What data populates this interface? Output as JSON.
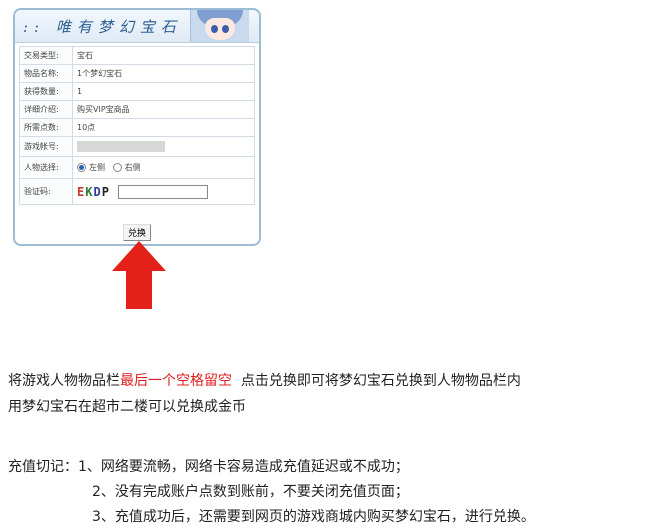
{
  "panel": {
    "title": "唯有梦幻宝石",
    "title_prefix": "::",
    "rows": [
      {
        "label": "交易类型:",
        "value": "宝石"
      },
      {
        "label": "物品名称:",
        "value": "1个梦幻宝石"
      },
      {
        "label": "获得数量:",
        "value": "1"
      },
      {
        "label": "详细介绍:",
        "value": "购买VIP宝商品"
      },
      {
        "label": "所需点数:",
        "value": "10点"
      }
    ],
    "account_label": "游戏帐号:",
    "character_label": "人物选择:",
    "radio_left": "左侧",
    "radio_right": "右侧",
    "captcha_label": "验证码:",
    "captcha_chars": [
      "E",
      "K",
      "D",
      "P"
    ],
    "captcha_value": "",
    "submit_label": "兑换"
  },
  "instructions": {
    "line1_prefix": "将游戏人物物品栏",
    "line1_highlight": "最后一个空格留空",
    "line1_suffix": "  点击兑换即可将梦幻宝石兑换到人物物品栏内",
    "line2": "用梦幻宝石在超市二楼可以兑换成金币"
  },
  "notes": {
    "line1": "充值切记：1、网络要流畅，网络卡容易造成充值延迟或不成功；",
    "line2": "2、没有完成账户点数到账前，不要关闭充值页面；",
    "line3": "3、充值成功后，还需要到网页的游戏商城内购买梦幻宝石，进行兑换。"
  },
  "colors": {
    "accent": "#2c5d93",
    "highlight": "#e02020",
    "arrow": "#e32119",
    "panel_border": "#9cbcd6"
  }
}
